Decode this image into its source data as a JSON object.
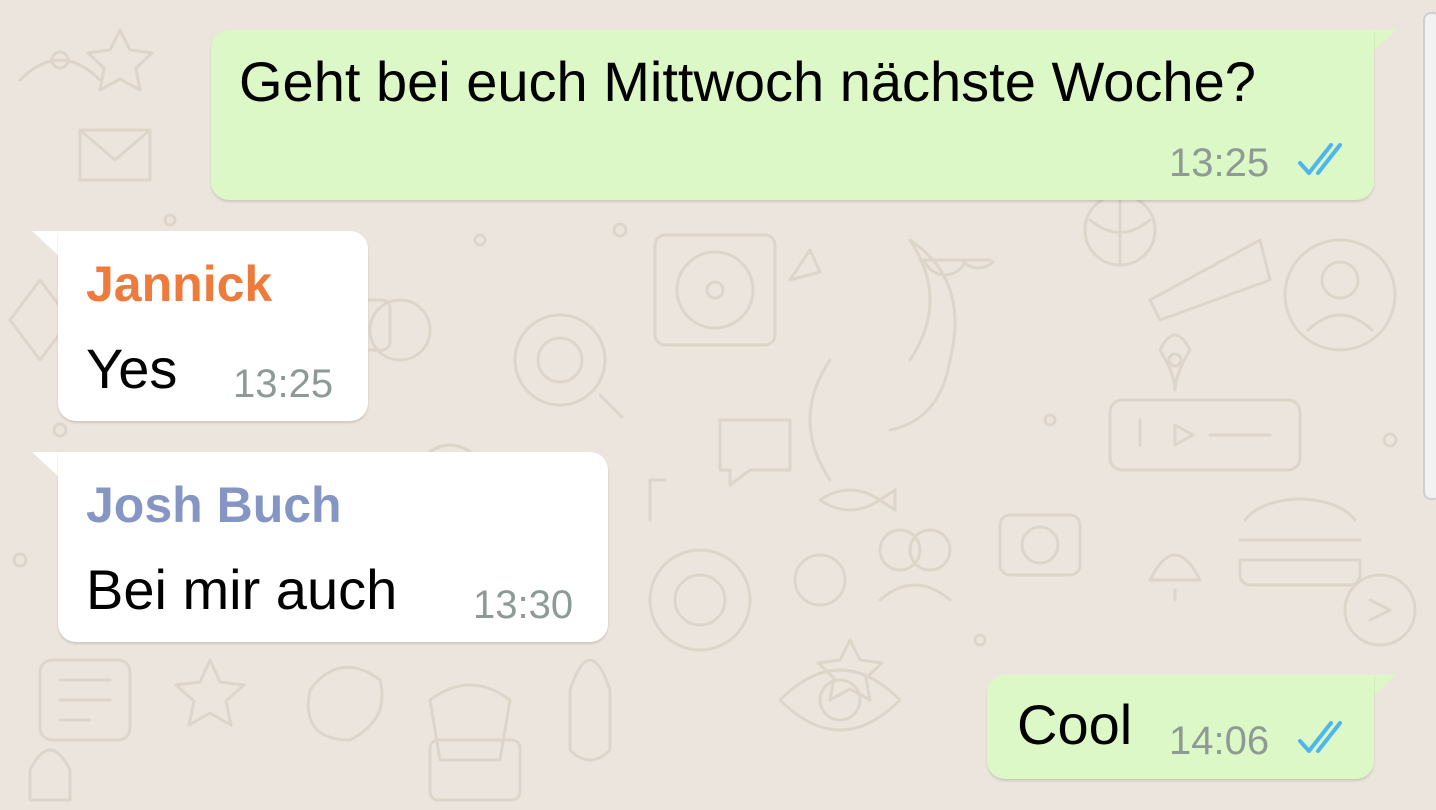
{
  "chat": {
    "messages": [
      {
        "direction": "outgoing",
        "text": "Geht bei euch Mittwoch nächste Woche?",
        "time": "13:25",
        "status": "read-double-check-icon"
      },
      {
        "direction": "incoming",
        "sender": "Jannick",
        "text": "Yes",
        "time": "13:25"
      },
      {
        "direction": "incoming",
        "sender": "Josh Buch",
        "text": "Bei mir auch",
        "time": "13:30"
      },
      {
        "direction": "outgoing",
        "text": "Cool",
        "time": "14:06",
        "status": "read-double-check-icon"
      }
    ]
  },
  "theme": {
    "background": "#ECE5DD",
    "outgoing_bubble": "#DCF8C6",
    "incoming_bubble": "#FFFFFF",
    "sender_colors": {
      "Jannick": "#EE7A3B",
      "Josh Buch": "#8596C5"
    },
    "timestamp_color": "#8E9A95",
    "read_tick_color": "#4FB6EC"
  }
}
